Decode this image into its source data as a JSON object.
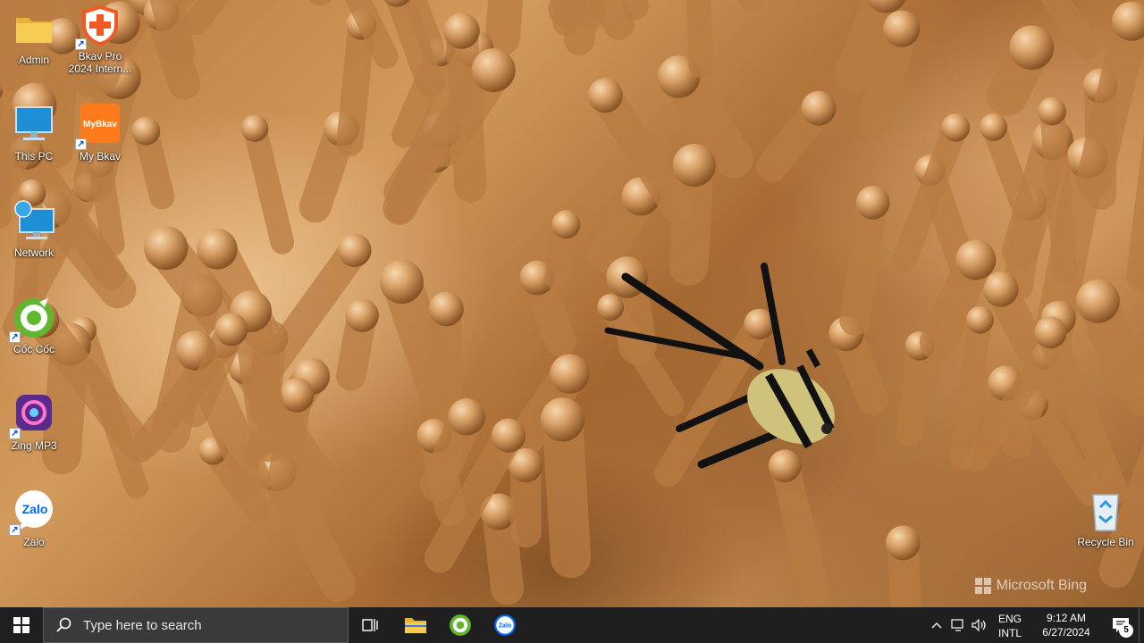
{
  "desktop": {
    "icons": [
      {
        "label": "Admin",
        "icon": "folder-icon"
      },
      {
        "label": "Bkav Pro\n2024 Intern...",
        "icon": "bkav-pro-icon"
      },
      {
        "label": "This PC",
        "icon": "this-pc-icon"
      },
      {
        "label": "My Bkav",
        "icon": "my-bkav-icon",
        "badge_text": "MyBkav"
      },
      {
        "label": "Network",
        "icon": "network-icon"
      },
      {
        "label": "Cốc Cốc",
        "icon": "coccoc-icon"
      },
      {
        "label": "Zing MP3",
        "icon": "zing-mp3-icon"
      },
      {
        "label": "Zalo",
        "icon": "zalo-icon",
        "badge_text": "Zalo"
      },
      {
        "label": "Recycle Bin",
        "icon": "recycle-bin-icon"
      }
    ],
    "watermark": "Microsoft Bing"
  },
  "taskbar": {
    "search_placeholder": "Type here to search",
    "pinned": [
      {
        "name": "task-view",
        "icon": "task-view-icon"
      },
      {
        "name": "file-explorer",
        "icon": "folder-icon"
      },
      {
        "name": "coccoc",
        "icon": "coccoc-icon"
      },
      {
        "name": "zalo",
        "icon": "zalo-icon",
        "badge_text": "Zalo"
      }
    ],
    "tray": {
      "lang_top": "ENG",
      "lang_bottom": "INTL",
      "time": "9:12 AM",
      "date": "6/27/2024",
      "notification_count": "5"
    }
  },
  "colors": {
    "taskbar_bg": "#1f1f1f",
    "search_bg": "#3a3a3a",
    "bkav_orange": "#f05a22",
    "coccoc_green": "#5fb82e",
    "zalo_blue": "#0068ff"
  }
}
